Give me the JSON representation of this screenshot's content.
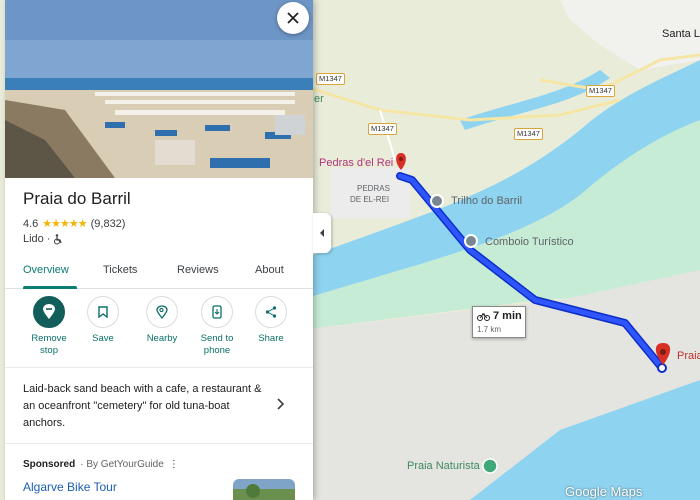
{
  "place": {
    "title": "Praia do Barril",
    "rating": "4.6",
    "stars": "★★★★★",
    "reviews_count": "(9,832)",
    "category": "Lido",
    "separator": "·",
    "accessibility_icon": "wheelchair-icon"
  },
  "tabs": [
    {
      "label": "Overview",
      "active": true
    },
    {
      "label": "Tickets"
    },
    {
      "label": "Reviews"
    },
    {
      "label": "About"
    }
  ],
  "actions": [
    {
      "label1": "Remove",
      "label2": "stop",
      "icon": "remove-stop-icon"
    },
    {
      "label1": "Save",
      "label2": "",
      "icon": "bookmark-icon"
    },
    {
      "label1": "Nearby",
      "label2": "",
      "icon": "nearby-icon"
    },
    {
      "label1": "Send to",
      "label2": "phone",
      "icon": "send-to-phone-icon"
    },
    {
      "label1": "Share",
      "label2": "",
      "icon": "share-icon"
    }
  ],
  "description": "Laid-back sand beach with a cafe, a restaurant & an oceanfront \"cemetery\" for old tuna-boat anchors.",
  "sponsored": {
    "label": "Sponsored",
    "by": "· By GetYourGuide",
    "more": "⋮",
    "ad_title": "Algarve Bike Tour"
  },
  "map": {
    "labels": {
      "santa": "Santa L",
      "er": "er",
      "pedras_del_rei": "Pedras d'el Rei",
      "pedras_de_el_rei_1": "PEDRAS",
      "pedras_de_el_rei_2": "DE EL-REI",
      "trilho": "Trilho do Barril",
      "comboio": "Comboio Turístico",
      "praia": "Praia",
      "praia_naturista": "Praia Naturista"
    },
    "roads": [
      "M1347",
      "M1347",
      "M1347",
      "M1347"
    ],
    "route": {
      "time": "7 min",
      "distance": "1.7 km",
      "mode": "bicycle-icon"
    },
    "logo": "Google Maps",
    "colors": {
      "water": "#8ed3ef",
      "land": "#e9ecd9",
      "green": "#c6ecd6",
      "sand": "#e4e4e0",
      "route": "#1a3ee8",
      "pin": "#d93025",
      "accent": "#0b7d73"
    }
  }
}
